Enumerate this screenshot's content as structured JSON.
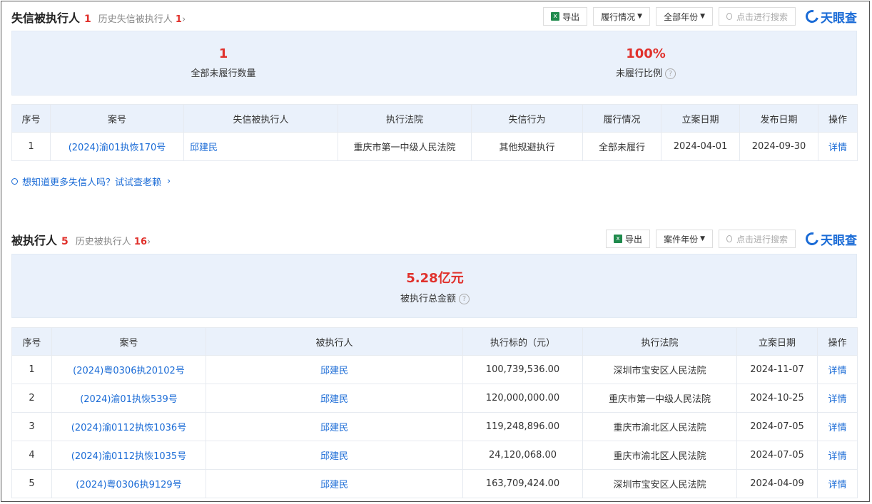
{
  "brand": {
    "name": "天眼查",
    "color": "#1a6bd6"
  },
  "accent_red": "#e0312c",
  "dishonest": {
    "title": "失信被执行人",
    "count": "1",
    "history_label": "历史失信被执行人",
    "history_count": "1",
    "export_label": "导出",
    "filter1": "履行情况",
    "filter2": "全部年份",
    "search_placeholder": "点击进行搜索",
    "stat1_value": "1",
    "stat1_label": "全部未履行数量",
    "stat2_value": "100%",
    "stat2_label": "未履行比例",
    "columns": [
      "序号",
      "案号",
      "失信被执行人",
      "执行法院",
      "失信行为",
      "履行情况",
      "立案日期",
      "发布日期",
      "操作"
    ],
    "rows": [
      {
        "no": "1",
        "case": "(2024)渝01执恢170号",
        "person": "邱建民",
        "court": "重庆市第一中级人民法院",
        "behavior": "其他规避执行",
        "status": "全部未履行",
        "filed": "2024-04-01",
        "published": "2024-09-30",
        "action": "详情"
      }
    ]
  },
  "hint": "想知道更多失信人吗？试试查老赖",
  "executed": {
    "title": "被执行人",
    "count": "5",
    "history_label": "历史被执行人",
    "history_count": "16",
    "export_label": "导出",
    "filter1": "案件年份",
    "search_placeholder": "点击进行搜索",
    "total_value": "5.28亿元",
    "total_label": "被执行总金额",
    "columns": [
      "序号",
      "案号",
      "被执行人",
      "执行标的（元）",
      "执行法院",
      "立案日期",
      "操作"
    ],
    "rows": [
      {
        "no": "1",
        "case": "(2024)粤0306执20102号",
        "person": "邱建民",
        "amount": "100,739,536.00",
        "court": "深圳市宝安区人民法院",
        "filed": "2024-11-07",
        "action": "详情"
      },
      {
        "no": "2",
        "case": "(2024)渝01执恢539号",
        "person": "邱建民",
        "amount": "120,000,000.00",
        "court": "重庆市第一中级人民法院",
        "filed": "2024-10-25",
        "action": "详情"
      },
      {
        "no": "3",
        "case": "(2024)渝0112执恢1036号",
        "person": "邱建民",
        "amount": "119,248,896.00",
        "court": "重庆市渝北区人民法院",
        "filed": "2024-07-05",
        "action": "详情"
      },
      {
        "no": "4",
        "case": "(2024)渝0112执恢1035号",
        "person": "邱建民",
        "amount": "24,120,068.00",
        "court": "重庆市渝北区人民法院",
        "filed": "2024-07-05",
        "action": "详情"
      },
      {
        "no": "5",
        "case": "(2024)粤0306执9129号",
        "person": "邱建民",
        "amount": "163,709,424.00",
        "court": "深圳市宝安区人民法院",
        "filed": "2024-04-09",
        "action": "详情"
      }
    ]
  }
}
